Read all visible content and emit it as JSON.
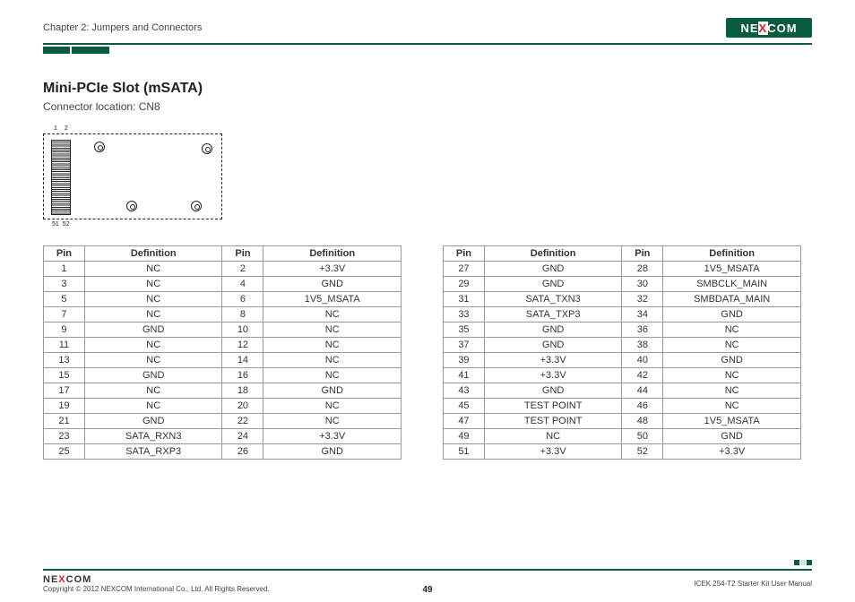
{
  "header": {
    "chapter": "Chapter 2: Jumpers and Connectors",
    "logo_text_pre": "NE",
    "logo_text_x": "X",
    "logo_text_post": "COM"
  },
  "section": {
    "title": "Mini-PCIe Slot (mSATA)",
    "subtitle": "Connector location: CN8"
  },
  "diagram": {
    "top_left": "1",
    "top_right": "2",
    "bot_left": "51",
    "bot_right": "52"
  },
  "table_headers": {
    "pin": "Pin",
    "def": "Definition"
  },
  "table_left": [
    {
      "p1": "1",
      "d1": "NC",
      "p2": "2",
      "d2": "+3.3V"
    },
    {
      "p1": "3",
      "d1": "NC",
      "p2": "4",
      "d2": "GND"
    },
    {
      "p1": "5",
      "d1": "NC",
      "p2": "6",
      "d2": "1V5_MSATA"
    },
    {
      "p1": "7",
      "d1": "NC",
      "p2": "8",
      "d2": "NC"
    },
    {
      "p1": "9",
      "d1": "GND",
      "p2": "10",
      "d2": "NC"
    },
    {
      "p1": "11",
      "d1": "NC",
      "p2": "12",
      "d2": "NC"
    },
    {
      "p1": "13",
      "d1": "NC",
      "p2": "14",
      "d2": "NC"
    },
    {
      "p1": "15",
      "d1": "GND",
      "p2": "16",
      "d2": "NC"
    },
    {
      "p1": "17",
      "d1": "NC",
      "p2": "18",
      "d2": "GND"
    },
    {
      "p1": "19",
      "d1": "NC",
      "p2": "20",
      "d2": "NC"
    },
    {
      "p1": "21",
      "d1": "GND",
      "p2": "22",
      "d2": "NC"
    },
    {
      "p1": "23",
      "d1": "SATA_RXN3",
      "p2": "24",
      "d2": "+3.3V"
    },
    {
      "p1": "25",
      "d1": "SATA_RXP3",
      "p2": "26",
      "d2": "GND"
    }
  ],
  "table_right": [
    {
      "p1": "27",
      "d1": "GND",
      "p2": "28",
      "d2": "1V5_MSATA"
    },
    {
      "p1": "29",
      "d1": "GND",
      "p2": "30",
      "d2": "SMBCLK_MAIN"
    },
    {
      "p1": "31",
      "d1": "SATA_TXN3",
      "p2": "32",
      "d2": "SMBDATA_MAIN"
    },
    {
      "p1": "33",
      "d1": "SATA_TXP3",
      "p2": "34",
      "d2": "GND"
    },
    {
      "p1": "35",
      "d1": "GND",
      "p2": "36",
      "d2": "NC"
    },
    {
      "p1": "37",
      "d1": "GND",
      "p2": "38",
      "d2": "NC"
    },
    {
      "p1": "39",
      "d1": "+3.3V",
      "p2": "40",
      "d2": "GND"
    },
    {
      "p1": "41",
      "d1": "+3.3V",
      "p2": "42",
      "d2": "NC"
    },
    {
      "p1": "43",
      "d1": "GND",
      "p2": "44",
      "d2": "NC"
    },
    {
      "p1": "45",
      "d1": "TEST POINT",
      "p2": "46",
      "d2": "NC"
    },
    {
      "p1": "47",
      "d1": "TEST POINT",
      "p2": "48",
      "d2": "1V5_MSATA"
    },
    {
      "p1": "49",
      "d1": "NC",
      "p2": "50",
      "d2": "GND"
    },
    {
      "p1": "51",
      "d1": "+3.3V",
      "p2": "52",
      "d2": "+3.3V"
    }
  ],
  "footer": {
    "logo_pre": "NE",
    "logo_x": "X",
    "logo_post": "COM",
    "copyright": "Copyright © 2012 NEXCOM International Co., Ltd. All Rights Reserved.",
    "page": "49",
    "manual": "ICEK 254-T2 Starter Kit User Manual"
  }
}
